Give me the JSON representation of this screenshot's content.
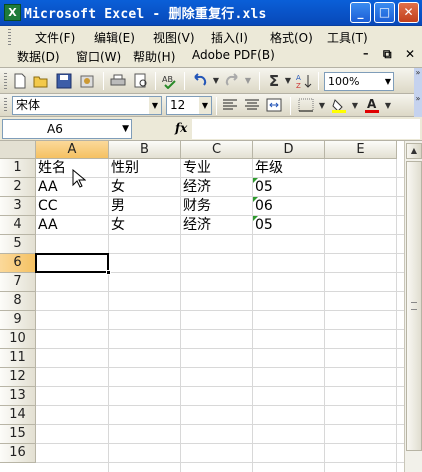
{
  "window": {
    "app_icon_glyph": "X",
    "title": "Microsoft Excel - 删除重复行.xls",
    "minimize_glyph": "_",
    "maximize_glyph": "□",
    "close_glyph": "✕"
  },
  "menu": {
    "row1": [
      "文件(F)",
      "编辑(E)",
      "视图(V)",
      "插入(I)",
      "格式(O)",
      "工具(T)"
    ],
    "row2": [
      "数据(D)",
      "窗口(W)",
      "帮助(H)",
      "Adobe PDF(B)"
    ],
    "doc_restore": "⧉",
    "doc_close": "✕"
  },
  "toolbar": {
    "zoom": "100%",
    "icons": [
      "new-icon",
      "open-icon",
      "save-icon",
      "permission-icon",
      "print-icon",
      "print-preview-icon",
      "spelling-icon",
      "undo-icon",
      "redo-icon",
      "autosum-icon",
      "sort-ascending-icon"
    ]
  },
  "format_toolbar": {
    "font_name": "宋体",
    "font_size": "12"
  },
  "formula_bar": {
    "name_box": "A6",
    "fx_label": "fx",
    "content": ""
  },
  "grid": {
    "columns": [
      "A",
      "B",
      "C",
      "D",
      "E"
    ],
    "active_column": "A",
    "active_row": 6,
    "rows": [
      1,
      2,
      3,
      4,
      5,
      6,
      7,
      8,
      9,
      10,
      11,
      12,
      13,
      14,
      15,
      16
    ],
    "data": [
      [
        "姓名",
        "性别",
        "专业",
        "年级"
      ],
      [
        "AA",
        "女",
        "经济",
        "05"
      ],
      [
        "CC",
        "男",
        "财务",
        "06"
      ],
      [
        "AA",
        "女",
        "经济",
        "05"
      ]
    ]
  }
}
